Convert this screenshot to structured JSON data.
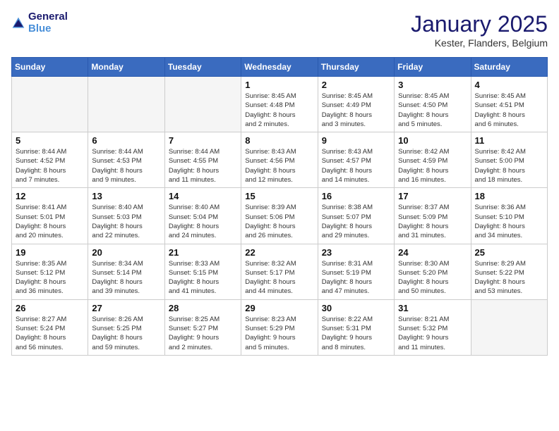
{
  "header": {
    "logo_line1": "General",
    "logo_line2": "Blue",
    "title": "January 2025",
    "subtitle": "Kester, Flanders, Belgium"
  },
  "weekdays": [
    "Sunday",
    "Monday",
    "Tuesday",
    "Wednesday",
    "Thursday",
    "Friday",
    "Saturday"
  ],
  "weeks": [
    [
      {
        "day": "",
        "info": ""
      },
      {
        "day": "",
        "info": ""
      },
      {
        "day": "",
        "info": ""
      },
      {
        "day": "1",
        "info": "Sunrise: 8:45 AM\nSunset: 4:48 PM\nDaylight: 8 hours\nand 2 minutes."
      },
      {
        "day": "2",
        "info": "Sunrise: 8:45 AM\nSunset: 4:49 PM\nDaylight: 8 hours\nand 3 minutes."
      },
      {
        "day": "3",
        "info": "Sunrise: 8:45 AM\nSunset: 4:50 PM\nDaylight: 8 hours\nand 5 minutes."
      },
      {
        "day": "4",
        "info": "Sunrise: 8:45 AM\nSunset: 4:51 PM\nDaylight: 8 hours\nand 6 minutes."
      }
    ],
    [
      {
        "day": "5",
        "info": "Sunrise: 8:44 AM\nSunset: 4:52 PM\nDaylight: 8 hours\nand 7 minutes."
      },
      {
        "day": "6",
        "info": "Sunrise: 8:44 AM\nSunset: 4:53 PM\nDaylight: 8 hours\nand 9 minutes."
      },
      {
        "day": "7",
        "info": "Sunrise: 8:44 AM\nSunset: 4:55 PM\nDaylight: 8 hours\nand 11 minutes."
      },
      {
        "day": "8",
        "info": "Sunrise: 8:43 AM\nSunset: 4:56 PM\nDaylight: 8 hours\nand 12 minutes."
      },
      {
        "day": "9",
        "info": "Sunrise: 8:43 AM\nSunset: 4:57 PM\nDaylight: 8 hours\nand 14 minutes."
      },
      {
        "day": "10",
        "info": "Sunrise: 8:42 AM\nSunset: 4:59 PM\nDaylight: 8 hours\nand 16 minutes."
      },
      {
        "day": "11",
        "info": "Sunrise: 8:42 AM\nSunset: 5:00 PM\nDaylight: 8 hours\nand 18 minutes."
      }
    ],
    [
      {
        "day": "12",
        "info": "Sunrise: 8:41 AM\nSunset: 5:01 PM\nDaylight: 8 hours\nand 20 minutes."
      },
      {
        "day": "13",
        "info": "Sunrise: 8:40 AM\nSunset: 5:03 PM\nDaylight: 8 hours\nand 22 minutes."
      },
      {
        "day": "14",
        "info": "Sunrise: 8:40 AM\nSunset: 5:04 PM\nDaylight: 8 hours\nand 24 minutes."
      },
      {
        "day": "15",
        "info": "Sunrise: 8:39 AM\nSunset: 5:06 PM\nDaylight: 8 hours\nand 26 minutes."
      },
      {
        "day": "16",
        "info": "Sunrise: 8:38 AM\nSunset: 5:07 PM\nDaylight: 8 hours\nand 29 minutes."
      },
      {
        "day": "17",
        "info": "Sunrise: 8:37 AM\nSunset: 5:09 PM\nDaylight: 8 hours\nand 31 minutes."
      },
      {
        "day": "18",
        "info": "Sunrise: 8:36 AM\nSunset: 5:10 PM\nDaylight: 8 hours\nand 34 minutes."
      }
    ],
    [
      {
        "day": "19",
        "info": "Sunrise: 8:35 AM\nSunset: 5:12 PM\nDaylight: 8 hours\nand 36 minutes."
      },
      {
        "day": "20",
        "info": "Sunrise: 8:34 AM\nSunset: 5:14 PM\nDaylight: 8 hours\nand 39 minutes."
      },
      {
        "day": "21",
        "info": "Sunrise: 8:33 AM\nSunset: 5:15 PM\nDaylight: 8 hours\nand 41 minutes."
      },
      {
        "day": "22",
        "info": "Sunrise: 8:32 AM\nSunset: 5:17 PM\nDaylight: 8 hours\nand 44 minutes."
      },
      {
        "day": "23",
        "info": "Sunrise: 8:31 AM\nSunset: 5:19 PM\nDaylight: 8 hours\nand 47 minutes."
      },
      {
        "day": "24",
        "info": "Sunrise: 8:30 AM\nSunset: 5:20 PM\nDaylight: 8 hours\nand 50 minutes."
      },
      {
        "day": "25",
        "info": "Sunrise: 8:29 AM\nSunset: 5:22 PM\nDaylight: 8 hours\nand 53 minutes."
      }
    ],
    [
      {
        "day": "26",
        "info": "Sunrise: 8:27 AM\nSunset: 5:24 PM\nDaylight: 8 hours\nand 56 minutes."
      },
      {
        "day": "27",
        "info": "Sunrise: 8:26 AM\nSunset: 5:25 PM\nDaylight: 8 hours\nand 59 minutes."
      },
      {
        "day": "28",
        "info": "Sunrise: 8:25 AM\nSunset: 5:27 PM\nDaylight: 9 hours\nand 2 minutes."
      },
      {
        "day": "29",
        "info": "Sunrise: 8:23 AM\nSunset: 5:29 PM\nDaylight: 9 hours\nand 5 minutes."
      },
      {
        "day": "30",
        "info": "Sunrise: 8:22 AM\nSunset: 5:31 PM\nDaylight: 9 hours\nand 8 minutes."
      },
      {
        "day": "31",
        "info": "Sunrise: 8:21 AM\nSunset: 5:32 PM\nDaylight: 9 hours\nand 11 minutes."
      },
      {
        "day": "",
        "info": ""
      }
    ]
  ]
}
